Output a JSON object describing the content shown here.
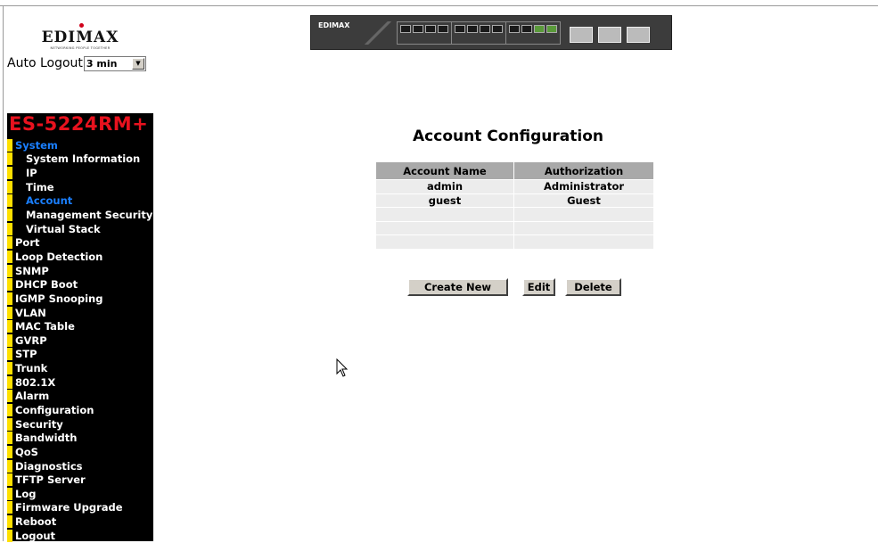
{
  "logo": {
    "name": "EDIMAX",
    "tagline": "NETWORKING PEOPLE TOGETHER"
  },
  "auto_logout": {
    "label": "Auto Logout",
    "selected": "3 min"
  },
  "switch_image": {
    "brand": "EDIMAX"
  },
  "sidebar": {
    "model": "ES-5224RM+",
    "items": [
      {
        "label": "System",
        "sub": false,
        "active": true
      },
      {
        "label": "System Information",
        "sub": true,
        "active": false
      },
      {
        "label": "IP",
        "sub": true,
        "active": false
      },
      {
        "label": "Time",
        "sub": true,
        "active": false
      },
      {
        "label": "Account",
        "sub": true,
        "active": true
      },
      {
        "label": "Management Security",
        "sub": true,
        "active": false
      },
      {
        "label": "Virtual Stack",
        "sub": true,
        "active": false
      },
      {
        "label": "Port",
        "sub": false,
        "active": false
      },
      {
        "label": "Loop Detection",
        "sub": false,
        "active": false
      },
      {
        "label": "SNMP",
        "sub": false,
        "active": false
      },
      {
        "label": "DHCP Boot",
        "sub": false,
        "active": false
      },
      {
        "label": "IGMP Snooping",
        "sub": false,
        "active": false
      },
      {
        "label": "VLAN",
        "sub": false,
        "active": false
      },
      {
        "label": "MAC Table",
        "sub": false,
        "active": false
      },
      {
        "label": "GVRP",
        "sub": false,
        "active": false
      },
      {
        "label": "STP",
        "sub": false,
        "active": false
      },
      {
        "label": "Trunk",
        "sub": false,
        "active": false
      },
      {
        "label": "802.1X",
        "sub": false,
        "active": false
      },
      {
        "label": "Alarm",
        "sub": false,
        "active": false
      },
      {
        "label": "Configuration",
        "sub": false,
        "active": false
      },
      {
        "label": "Security",
        "sub": false,
        "active": false
      },
      {
        "label": "Bandwidth",
        "sub": false,
        "active": false
      },
      {
        "label": "QoS",
        "sub": false,
        "active": false
      },
      {
        "label": "Diagnostics",
        "sub": false,
        "active": false
      },
      {
        "label": "TFTP Server",
        "sub": false,
        "active": false
      },
      {
        "label": "Log",
        "sub": false,
        "active": false
      },
      {
        "label": "Firmware Upgrade",
        "sub": false,
        "active": false
      },
      {
        "label": "Reboot",
        "sub": false,
        "active": false
      },
      {
        "label": "Logout",
        "sub": false,
        "active": false
      }
    ]
  },
  "main": {
    "title": "Account Configuration",
    "table": {
      "headers": [
        "Account Name",
        "Authorization"
      ],
      "rows": [
        [
          "admin",
          "Administrator"
        ],
        [
          "guest",
          "Guest"
        ],
        [
          "",
          ""
        ],
        [
          "",
          ""
        ],
        [
          "",
          ""
        ]
      ]
    },
    "buttons": {
      "create_new": "Create New",
      "edit": "Edit",
      "delete": "Delete"
    }
  },
  "colors": {
    "sidebar_bg": "#000000",
    "model_red": "#e8121e",
    "nav_bar_yellow": "#ffe000",
    "active_blue": "#1a7fff",
    "table_header": "#a9a9a9",
    "table_row": "#ececec"
  }
}
